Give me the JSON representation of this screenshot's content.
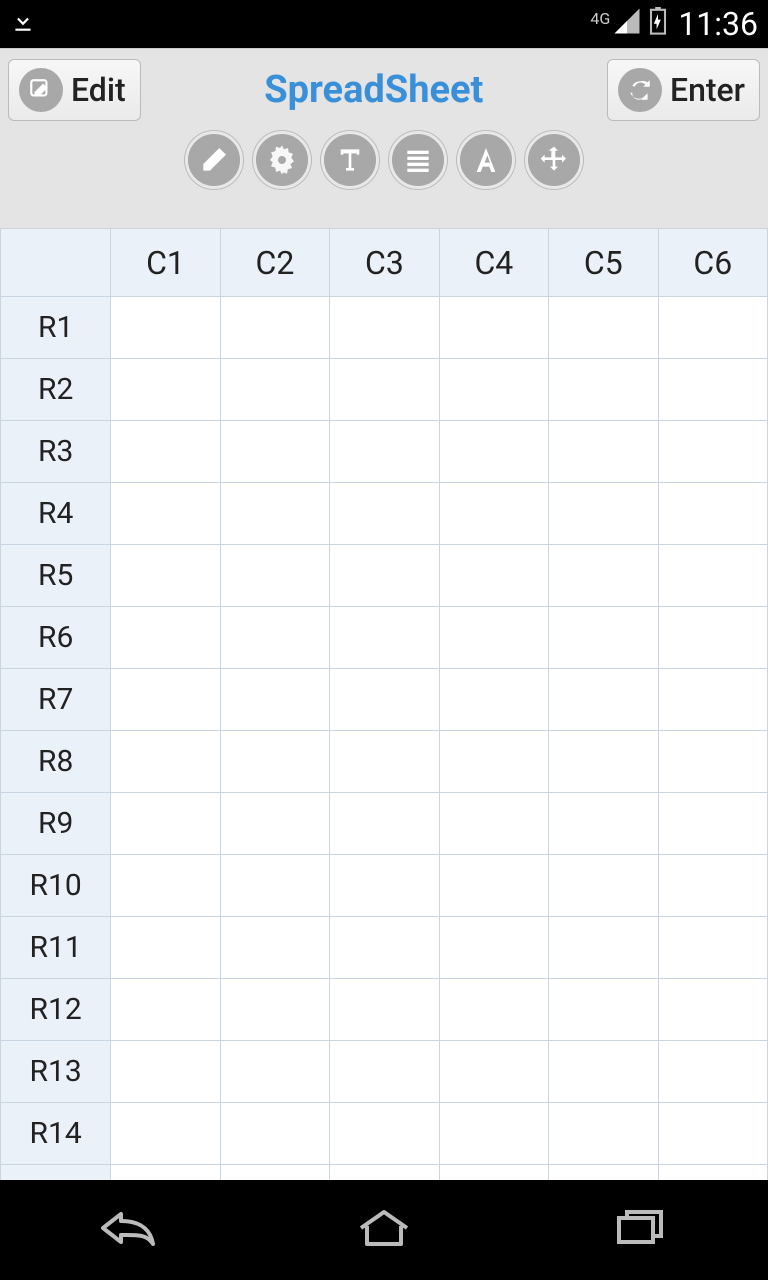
{
  "status": {
    "network": "4G",
    "time": "11:36"
  },
  "header": {
    "edit_label": "Edit",
    "title": "SpreadSheet",
    "enter_label": "Enter"
  },
  "toolbar": {
    "items": [
      "erase-icon",
      "settings-icon",
      "text-style-icon",
      "lines-icon",
      "font-icon",
      "move-icon"
    ]
  },
  "grid": {
    "columns": [
      "C1",
      "C2",
      "C3",
      "C4",
      "C5",
      "C6"
    ],
    "rows": [
      "R1",
      "R2",
      "R3",
      "R4",
      "R5",
      "R6",
      "R7",
      "R8",
      "R9",
      "R10",
      "R11",
      "R12",
      "R13",
      "R14"
    ]
  }
}
